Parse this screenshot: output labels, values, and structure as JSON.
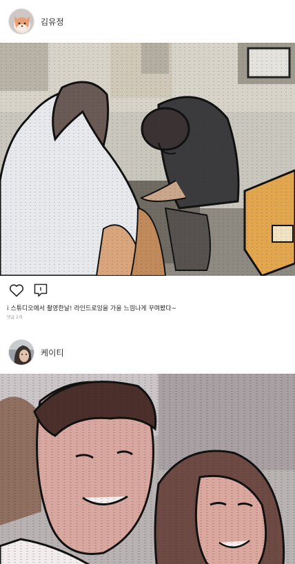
{
  "posts": [
    {
      "username": "김유정",
      "avatar": "fox-cartoon-avatar",
      "photo": "couple-in-studio-cartoon-photo",
      "caption": "i 스튜디오에서 촬영한날! 라인드로잉을 가을 느낌나게 꾸며봤다~",
      "comments_label": "댓글 2개"
    },
    {
      "username": "케이티",
      "avatar": "portrait-avatar",
      "photo": "couple-selfie-cartoon-photo"
    }
  ],
  "icons": {
    "like": "heart-icon",
    "comment": "comment-icon"
  },
  "colors": {
    "text": "#222222",
    "subtext": "#999999",
    "background": "#ffffff"
  }
}
